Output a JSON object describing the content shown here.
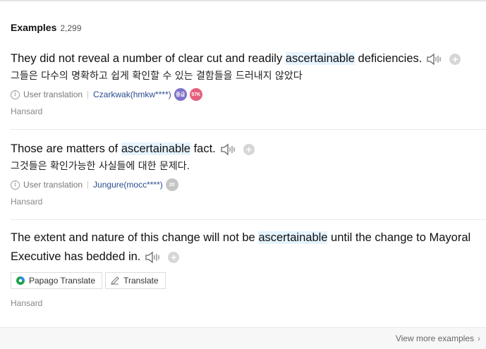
{
  "header": {
    "title": "Examples",
    "count": "2,299"
  },
  "examples": [
    {
      "pre": "They did not reveal a number of clear cut and readily ",
      "keyword": "ascertainable",
      "post": " deficiencies.",
      "translation": "그들은 다수의 명확하고 쉽게 확인할 수 있는 결함들을 드러내지 않았다",
      "meta_label": "User translation",
      "user": "Czarkwak(hmkw****)",
      "badges": [
        "중급",
        "57K"
      ],
      "source": "Hansard"
    },
    {
      "pre": "Those are matters of ",
      "keyword": "ascertainable",
      "post": " fact.",
      "translation": "그것들은 확인가능한 사실들에 대한 문제다.",
      "meta_label": "User translation",
      "user": "Jungure(mocc****)",
      "badges": [
        "20"
      ],
      "source": "Hansard"
    },
    {
      "pre": "The extent and nature of this change will not be ",
      "keyword": "ascertainable",
      "post": " until the change to Mayoral Executive has bedded in.",
      "buttons": {
        "papago": "Papago Translate",
        "translate": "Translate"
      },
      "source": "Hansard"
    }
  ],
  "footer": {
    "more_label": "View more examples"
  },
  "colors": {
    "highlight": "#e5f4ff",
    "user_link": "#2a4d8f",
    "badge_purple": "#7f72c8",
    "badge_pink": "#e55f7f"
  },
  "icons": [
    "speaker-icon",
    "plus-icon",
    "info-icon",
    "papago-icon",
    "pencil-icon",
    "chevron-right-icon"
  ]
}
